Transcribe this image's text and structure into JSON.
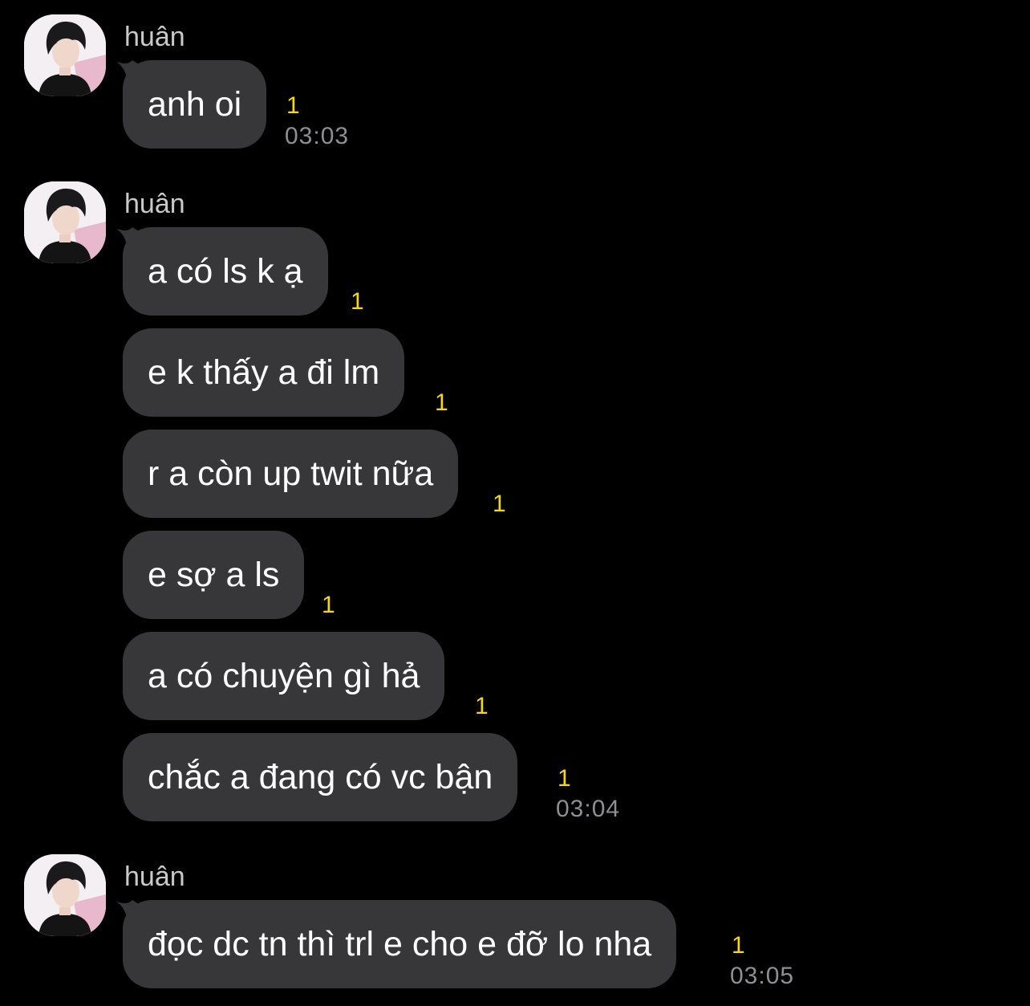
{
  "colors": {
    "background": "#000000",
    "bubble": "#37373a",
    "message_text": "#ffffff",
    "sender_text": "#c9c9c9",
    "unread_count": "#f5d90a",
    "timestamp": "#8e8e93"
  },
  "chat": {
    "groups": [
      {
        "sender": "huân",
        "avatar_icon": "user-avatar-icon",
        "messages": [
          {
            "text": "anh oi",
            "unread": "1",
            "time": "03:03"
          }
        ]
      },
      {
        "sender": "huân",
        "avatar_icon": "user-avatar-icon",
        "messages": [
          {
            "text": "a có ls k ạ",
            "unread": "1"
          },
          {
            "text": "e k thấy a đi lm",
            "unread": "1"
          },
          {
            "text": "r a còn up twit nữa",
            "unread": "1"
          },
          {
            "text": "e sợ a ls",
            "unread": "1"
          },
          {
            "text": "a có chuyện gì hả",
            "unread": "1"
          },
          {
            "text": "chắc a đang có vc bận",
            "unread": "1",
            "time": "03:04"
          }
        ]
      },
      {
        "sender": "huân",
        "avatar_icon": "user-avatar-icon",
        "messages": [
          {
            "text": "đọc dc tn thì trl e cho e đỡ lo nha",
            "unread": "1",
            "time": "03:05"
          }
        ]
      }
    ]
  }
}
